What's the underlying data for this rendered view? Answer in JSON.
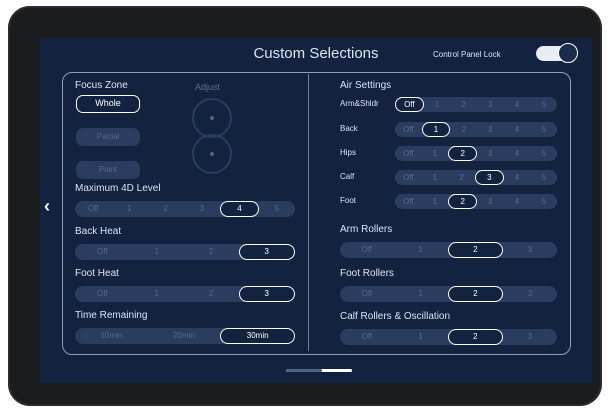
{
  "header": {
    "title": "Custom Selections",
    "lock_label": "Control Panel Lock"
  },
  "focus_zone": {
    "label": "Focus Zone",
    "options": [
      "Whole",
      "Partial",
      "Point"
    ],
    "selected": "Whole"
  },
  "adjust": {
    "label": "Adjust"
  },
  "max4d": {
    "label": "Maximum 4D Level",
    "options": [
      "Off",
      "1",
      "2",
      "3",
      "4",
      "5"
    ],
    "selected": "4"
  },
  "back_heat": {
    "label": "Back Heat",
    "options": [
      "Off",
      "1",
      "2",
      "3"
    ],
    "selected": "3"
  },
  "foot_heat": {
    "label": "Foot Heat",
    "options": [
      "Off",
      "1",
      "2",
      "3"
    ],
    "selected": "3"
  },
  "time_remaining": {
    "label": "Time Remaining",
    "options": [
      "10min",
      "20min",
      "30min"
    ],
    "selected": "30min"
  },
  "air_settings": {
    "label": "Air Settings",
    "rows": [
      {
        "label": "Arm&Shldr",
        "options": [
          "Off",
          "1",
          "2",
          "3",
          "4",
          "5"
        ],
        "selected": "Off"
      },
      {
        "label": "Back",
        "options": [
          "Off",
          "1",
          "2",
          "3",
          "4",
          "5"
        ],
        "selected": "1"
      },
      {
        "label": "Hips",
        "options": [
          "Off",
          "1",
          "2",
          "3",
          "4",
          "5"
        ],
        "selected": "2"
      },
      {
        "label": "Calf",
        "options": [
          "Off",
          "1",
          "2",
          "3",
          "4",
          "5"
        ],
        "selected": "3"
      },
      {
        "label": "Foot",
        "options": [
          "Off",
          "1",
          "2",
          "3",
          "4",
          "5"
        ],
        "selected": "2"
      }
    ]
  },
  "arm_rollers": {
    "label": "Arm Rollers",
    "options": [
      "Off",
      "1",
      "2",
      "3"
    ],
    "selected": "2"
  },
  "foot_rollers": {
    "label": "Foot Rollers",
    "options": [
      "Off",
      "1",
      "2",
      "3"
    ],
    "selected": "2"
  },
  "calf_rollers": {
    "label": "Calf Rollers & Oscillation",
    "options": [
      "Off",
      "1",
      "2",
      "3"
    ],
    "selected": "2"
  },
  "colors": {
    "background": "#13223f",
    "track": "#2a3d5e",
    "selected_border": "#ffffff",
    "text": "#dbe4f2"
  },
  "icons": {
    "back": "chevron-left-icon",
    "lock_toggle": "toggle-switch"
  }
}
